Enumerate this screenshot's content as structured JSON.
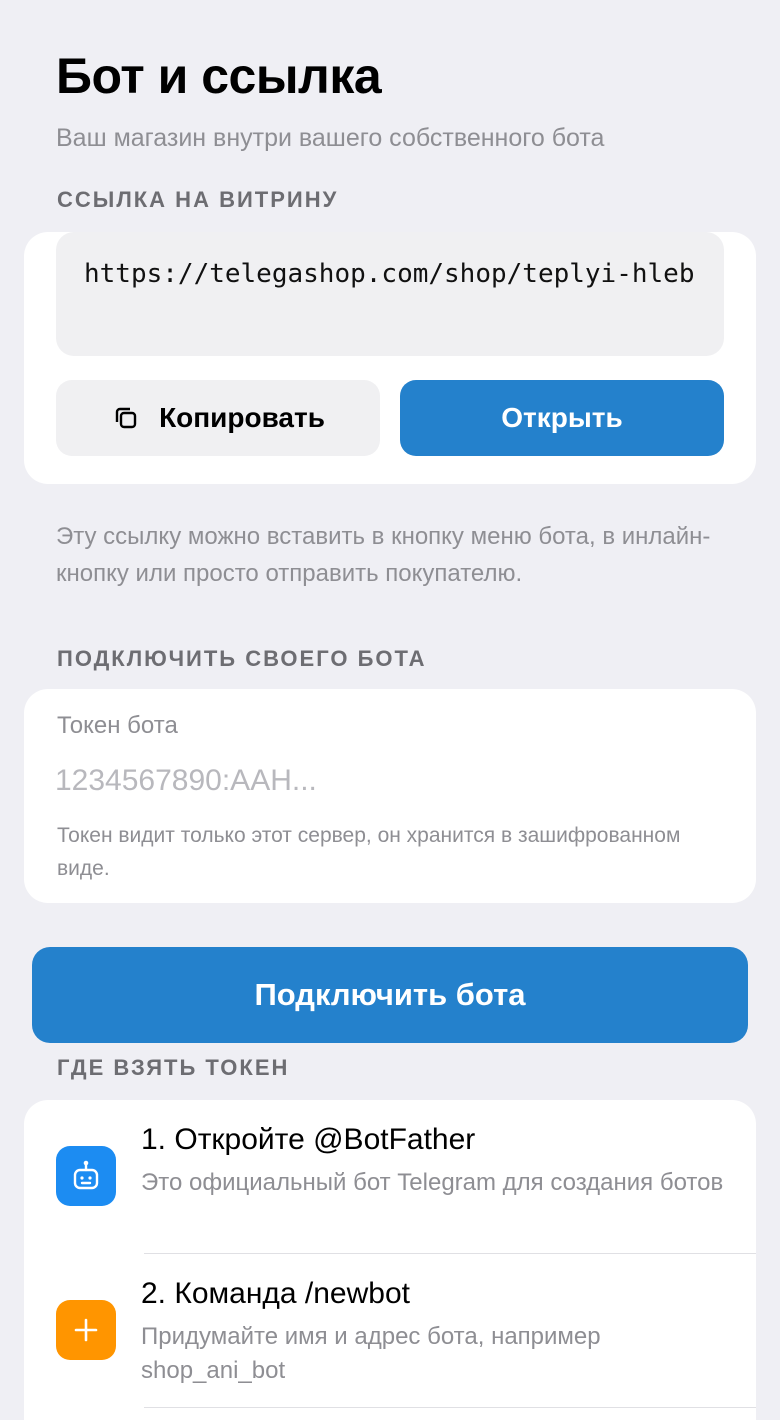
{
  "header": {
    "title": "Бот и ссылка",
    "subtitle": "Ваш магазин внутри вашего собственного бота"
  },
  "storefront": {
    "section_label": "ССЫЛКА НА ВИТРИНУ",
    "url": "https://telegashop.com/shop/teplyi-hleb",
    "copy_label": "Копировать",
    "open_label": "Открыть",
    "note": "Эту ссылку можно вставить в кнопку меню бота, в инлайн-кнопку или просто отправить покупателю."
  },
  "connect": {
    "section_label": "ПОДКЛЮЧИТЬ СВОЕГО БОТА",
    "field_label": "Токен бота",
    "field_value": "",
    "field_placeholder": "1234567890:AAH...",
    "field_hint": "Токен видит только этот сервер, он хранится в зашифрованном виде.",
    "button_label": "Подключить бота"
  },
  "howto": {
    "section_label": "ГДЕ ВЗЯТЬ ТОКЕН",
    "steps": [
      {
        "title": "1. Откройте @BotFather",
        "description": "Это официальный бот Telegram для создания ботов",
        "icon": "robot-icon",
        "color": "#1c8cf2"
      },
      {
        "title": "2. Команда /newbot",
        "description": "Придумайте имя и адрес бота, например shop_ani_bot",
        "icon": "plus-icon",
        "color": "#ff9500"
      }
    ]
  },
  "colors": {
    "accent": "#2481cc",
    "background": "#efeff4",
    "card": "#ffffff",
    "secondary_text": "#8e8e93"
  }
}
